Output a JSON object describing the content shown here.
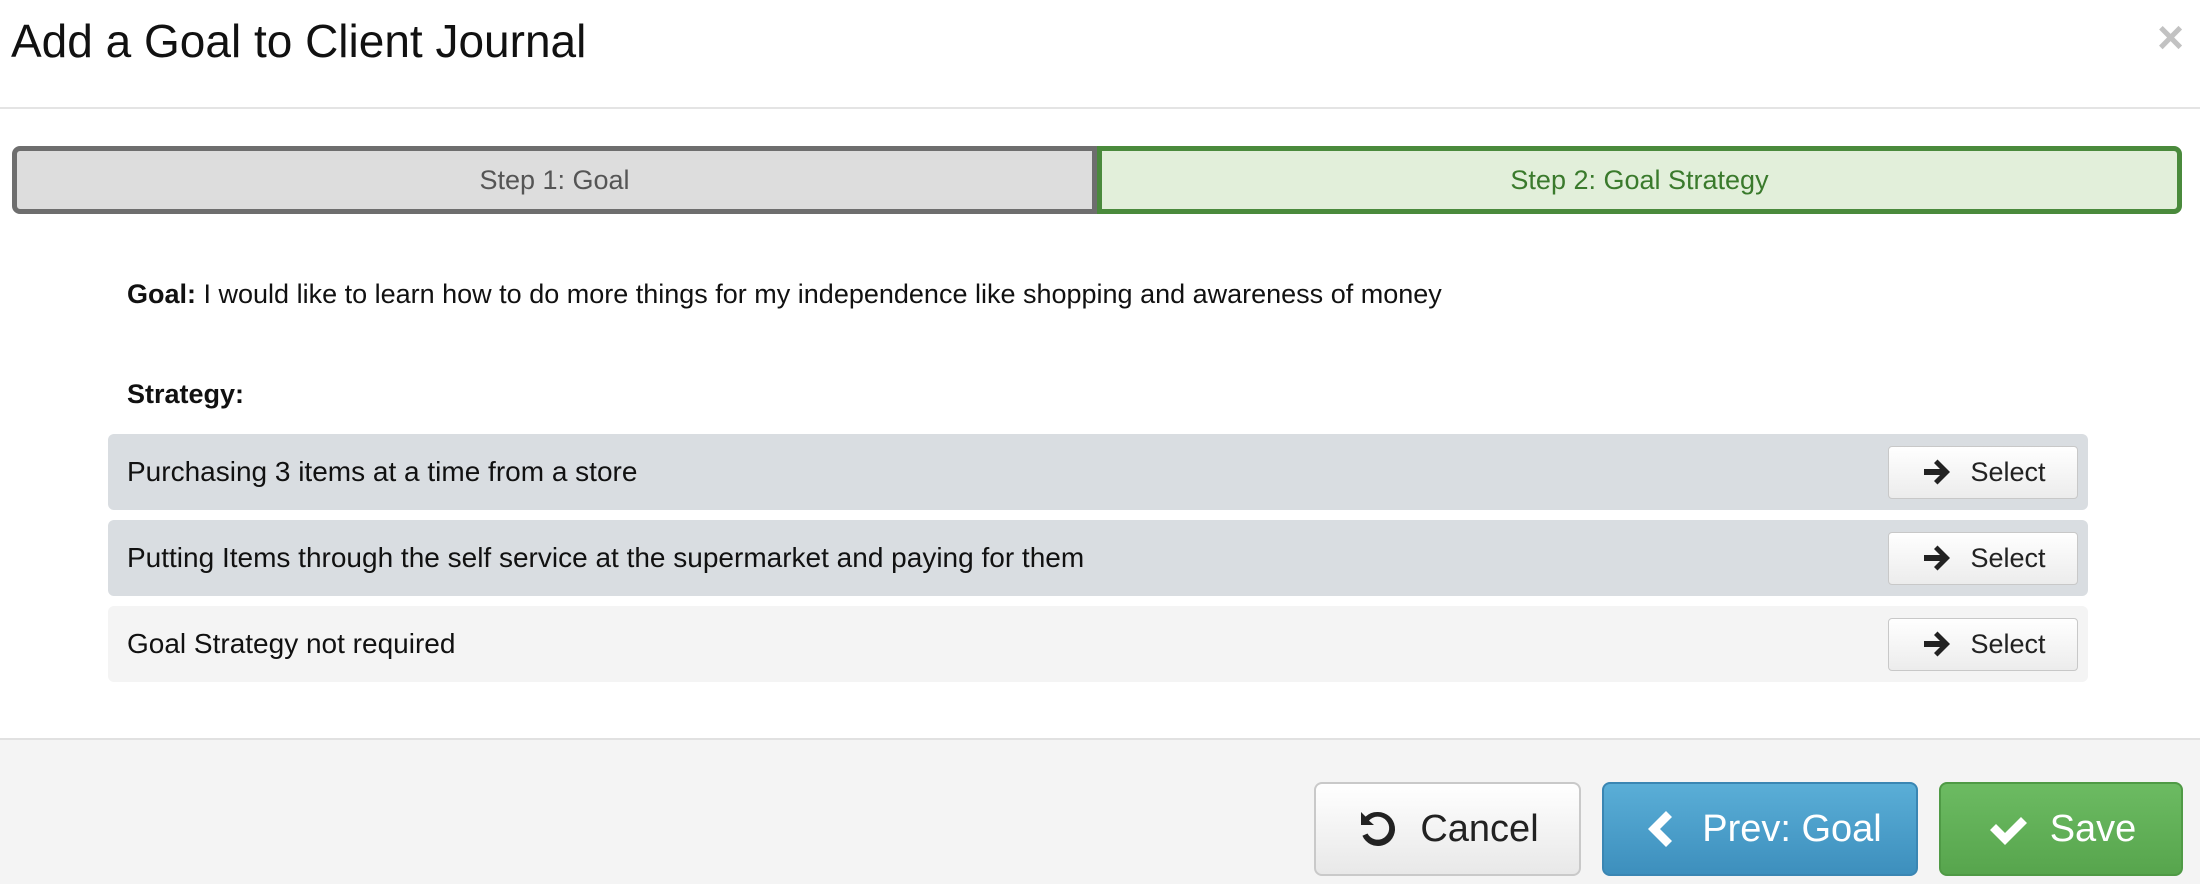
{
  "modal": {
    "title": "Add a Goal to Client Journal",
    "close_glyph": "×"
  },
  "steps": [
    {
      "label": "Step 1: Goal",
      "state": "inactive"
    },
    {
      "label": "Step 2: Goal Strategy",
      "state": "active"
    }
  ],
  "goal": {
    "label": "Goal:",
    "text": " I would like to learn how to do more things for my independence like shopping and awareness of money"
  },
  "strategy": {
    "heading": "Strategy:",
    "items": [
      {
        "text": "Purchasing 3 items at a time from a store",
        "button_label": "Select"
      },
      {
        "text": "Putting Items through the self service at the supermarket and paying for them",
        "button_label": "Select"
      },
      {
        "text": "Goal Strategy not required",
        "button_label": "Select"
      }
    ]
  },
  "footer": {
    "cancel_label": "Cancel",
    "prev_label": "Prev: Goal",
    "save_label": "Save"
  },
  "colors": {
    "step_active_bg": "#e2efda",
    "step_active_border": "#4a8a3c",
    "prev_button": "#4a9bc9",
    "save_button": "#62b058"
  },
  "icons": [
    "close-icon",
    "arrow-right-icon",
    "undo-icon",
    "chevron-left-icon",
    "check-icon"
  ]
}
